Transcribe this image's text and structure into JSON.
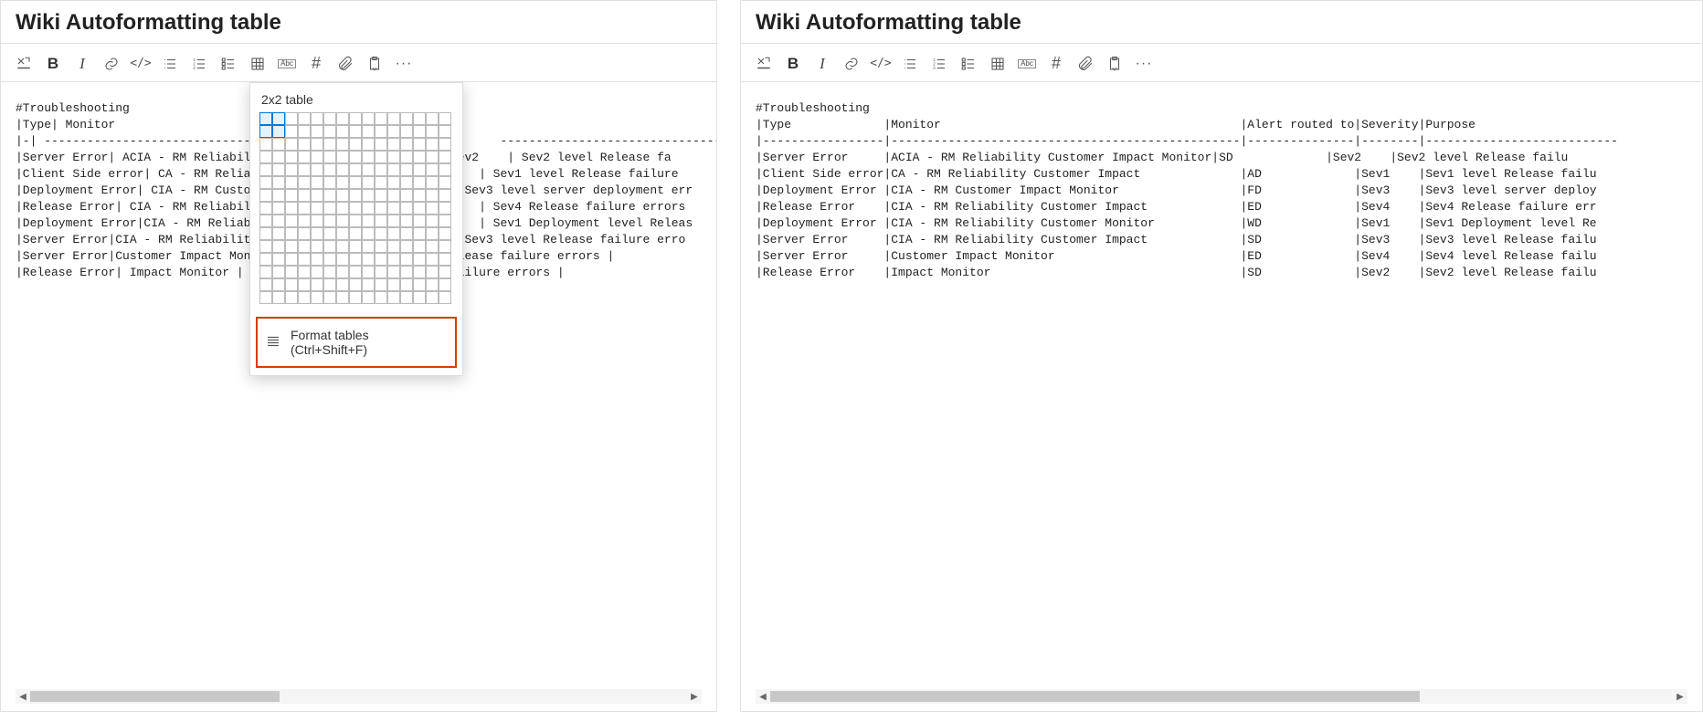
{
  "left": {
    "title": "Wiki Autoformatting table",
    "popover": {
      "size_label": "2x2 table",
      "format_label": "Format tables (Ctrl+Shift+F)"
    },
    "lines": [
      "#Troubleshooting",
      "|Type| Monitor",
      "|-| ---------------------------------------------                   --------------------------------",
      "|Server Error| ACIA - RM Reliability Cu                    | Sev2    | Sev2 level Release fa",
      "|Client Side error| CA - RM Reliability                | Sev1    | Sev1 level Release failure",
      "|Deployment Error| CIA - RM Customer Im                v3    | Sev3 level server deployment err",
      "|Release Error| CIA - RM Reliability Cu                  Sev4    | Sev4 Release failure errors",
      "|Deployment Error|CIA - RM Reliability                   Sev1    | Sev1 Deployment level Releas",
      "|Server Error|CIA - RM Reliability Cust                v3    | Sev3 level Release failure erro",
      "|Server Error|Customer Impact Monitor                 level Release failure errors |",
      "|Release Error| Impact Monitor | SD                   elease failure errors |"
    ]
  },
  "right": {
    "title": "Wiki Autoformatting table",
    "lines": [
      "#Troubleshooting",
      "|Type             |Monitor                                          |Alert routed to|Severity|Purpose",
      "|-----------------|-------------------------------------------------|---------------|--------|---------------------------",
      "|Server Error     |ACIA - RM Reliability Customer Impact Monitor|SD             |Sev2    |Sev2 level Release failu",
      "|Client Side error|CA - RM Reliability Customer Impact              |AD             |Sev1    |Sev1 level Release failu",
      "|Deployment Error |CIA - RM Customer Impact Monitor                 |FD             |Sev3    |Sev3 level server deploy",
      "|Release Error    |CIA - RM Reliability Customer Impact             |ED             |Sev4    |Sev4 Release failure err",
      "|Deployment Error |CIA - RM Reliability Customer Monitor            |WD             |Sev1    |Sev1 Deployment level Re",
      "|Server Error     |CIA - RM Reliability Customer Impact             |SD             |Sev3    |Sev3 level Release failu",
      "|Server Error     |Customer Impact Monitor                          |ED             |Sev4    |Sev4 level Release failu",
      "|Release Error    |Impact Monitor                                   |SD             |Sev2    |Sev2 level Release failu"
    ]
  },
  "icons": {
    "format": "format-painter",
    "bold": "B",
    "italic": "I",
    "code": "</>",
    "abc": "Abc",
    "hash": "#",
    "ellipsis": "···"
  }
}
